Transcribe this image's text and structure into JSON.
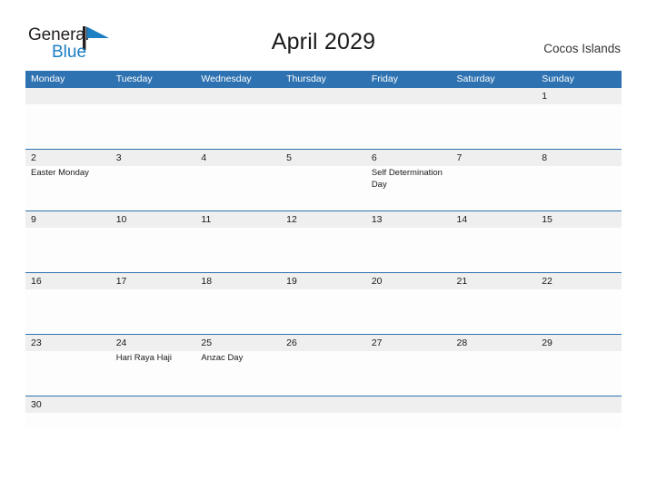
{
  "brand": {
    "name_part1": "General",
    "name_part2": "Blue",
    "flag_icon": "flag-triangle-icon",
    "color_dark": "#231f20",
    "color_blue": "#1b7fc4"
  },
  "header": {
    "title": "April 2029",
    "region": "Cocos Islands"
  },
  "theme": {
    "header_blue": "#2e72b1",
    "daynum_band": "#efefef",
    "cell_background": "#fdfdfd",
    "text": "#1a1a1a"
  },
  "calendar": {
    "weekdays": [
      "Monday",
      "Tuesday",
      "Wednesday",
      "Thursday",
      "Friday",
      "Saturday",
      "Sunday"
    ],
    "weeks": [
      {
        "days": [
          {
            "number": "",
            "event": ""
          },
          {
            "number": "",
            "event": ""
          },
          {
            "number": "",
            "event": ""
          },
          {
            "number": "",
            "event": ""
          },
          {
            "number": "",
            "event": ""
          },
          {
            "number": "",
            "event": ""
          },
          {
            "number": "1",
            "event": ""
          }
        ]
      },
      {
        "days": [
          {
            "number": "2",
            "event": "Easter Monday"
          },
          {
            "number": "3",
            "event": ""
          },
          {
            "number": "4",
            "event": ""
          },
          {
            "number": "5",
            "event": ""
          },
          {
            "number": "6",
            "event": "Self Determination Day"
          },
          {
            "number": "7",
            "event": ""
          },
          {
            "number": "8",
            "event": ""
          }
        ]
      },
      {
        "days": [
          {
            "number": "9",
            "event": ""
          },
          {
            "number": "10",
            "event": ""
          },
          {
            "number": "11",
            "event": ""
          },
          {
            "number": "12",
            "event": ""
          },
          {
            "number": "13",
            "event": ""
          },
          {
            "number": "14",
            "event": ""
          },
          {
            "number": "15",
            "event": ""
          }
        ]
      },
      {
        "days": [
          {
            "number": "16",
            "event": ""
          },
          {
            "number": "17",
            "event": ""
          },
          {
            "number": "18",
            "event": ""
          },
          {
            "number": "19",
            "event": ""
          },
          {
            "number": "20",
            "event": ""
          },
          {
            "number": "21",
            "event": ""
          },
          {
            "number": "22",
            "event": ""
          }
        ]
      },
      {
        "days": [
          {
            "number": "23",
            "event": ""
          },
          {
            "number": "24",
            "event": "Hari Raya Haji"
          },
          {
            "number": "25",
            "event": "Anzac Day"
          },
          {
            "number": "26",
            "event": ""
          },
          {
            "number": "27",
            "event": ""
          },
          {
            "number": "28",
            "event": ""
          },
          {
            "number": "29",
            "event": ""
          }
        ]
      },
      {
        "days": [
          {
            "number": "30",
            "event": ""
          },
          {
            "number": "",
            "event": ""
          },
          {
            "number": "",
            "event": ""
          },
          {
            "number": "",
            "event": ""
          },
          {
            "number": "",
            "event": ""
          },
          {
            "number": "",
            "event": ""
          },
          {
            "number": "",
            "event": ""
          }
        ]
      }
    ]
  }
}
